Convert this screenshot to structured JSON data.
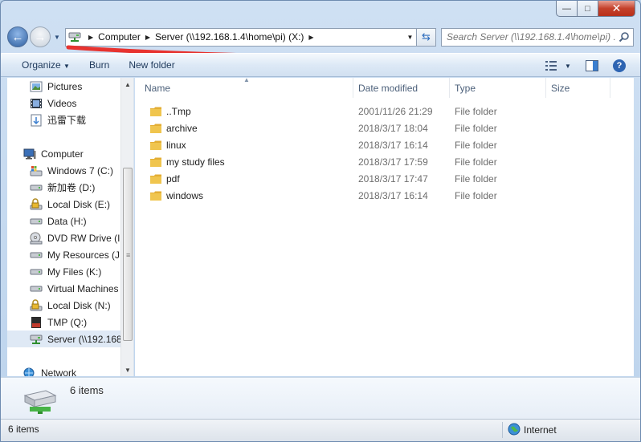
{
  "window": {
    "caption_buttons": {
      "minimize": "—",
      "maximize": "□",
      "close": "✕"
    }
  },
  "address_bar": {
    "breadcrumbs": [
      "Computer",
      "Server (\\\\192.168.1.4\\home\\pi) (X:)"
    ],
    "search_placeholder": "Search Server (\\\\192.168.1.4\\home\\pi) ..."
  },
  "toolbar": {
    "organize_label": "Organize",
    "burn_label": "Burn",
    "new_folder_label": "New folder"
  },
  "nav_pane": {
    "items": [
      {
        "label": "Pictures",
        "icon": "pictures-icon"
      },
      {
        "label": "Videos",
        "icon": "videos-icon"
      },
      {
        "label": "迅雷下载",
        "icon": "download-folder-icon"
      },
      {
        "label": "Computer",
        "icon": "computer-icon"
      },
      {
        "label": "Windows 7 (C:)",
        "icon": "system-drive-icon"
      },
      {
        "label": "新加卷 (D:)",
        "icon": "drive-icon"
      },
      {
        "label": "Local Disk (E:)",
        "icon": "locked-drive-icon"
      },
      {
        "label": "Data (H:)",
        "icon": "drive-icon"
      },
      {
        "label": "DVD RW Drive (I:)",
        "icon": "dvd-drive-icon"
      },
      {
        "label": "My Resources (J:)",
        "icon": "drive-icon"
      },
      {
        "label": "My Files (K:)",
        "icon": "drive-icon"
      },
      {
        "label": "Virtual Machines",
        "icon": "drive-icon"
      },
      {
        "label": "Local Disk (N:)",
        "icon": "locked-drive-icon"
      },
      {
        "label": "TMP (Q:)",
        "icon": "sd-card-icon"
      },
      {
        "label": "Server (\\\\192.168",
        "icon": "network-drive-icon"
      },
      {
        "label": "Network",
        "icon": "network-icon"
      }
    ]
  },
  "file_list": {
    "columns": {
      "name": "Name",
      "date": "Date modified",
      "type": "Type",
      "size": "Size"
    },
    "rows": [
      {
        "name": "..Tmp",
        "date": "2001/11/26 21:29",
        "type": "File folder"
      },
      {
        "name": "archive",
        "date": "2018/3/17 18:04",
        "type": "File folder"
      },
      {
        "name": "linux",
        "date": "2018/3/17 16:14",
        "type": "File folder"
      },
      {
        "name": "my study files",
        "date": "2018/3/17 17:59",
        "type": "File folder"
      },
      {
        "name": "pdf",
        "date": "2018/3/17 17:47",
        "type": "File folder"
      },
      {
        "name": "windows",
        "date": "2018/3/17 16:14",
        "type": "File folder"
      }
    ]
  },
  "details_pane": {
    "count": "6 items"
  },
  "status_bar": {
    "count": "6 items",
    "zone": "Internet"
  },
  "colors": {
    "annotation": "#e8332f",
    "folder": "#f0c54e",
    "selection": "#dfe9f5"
  }
}
